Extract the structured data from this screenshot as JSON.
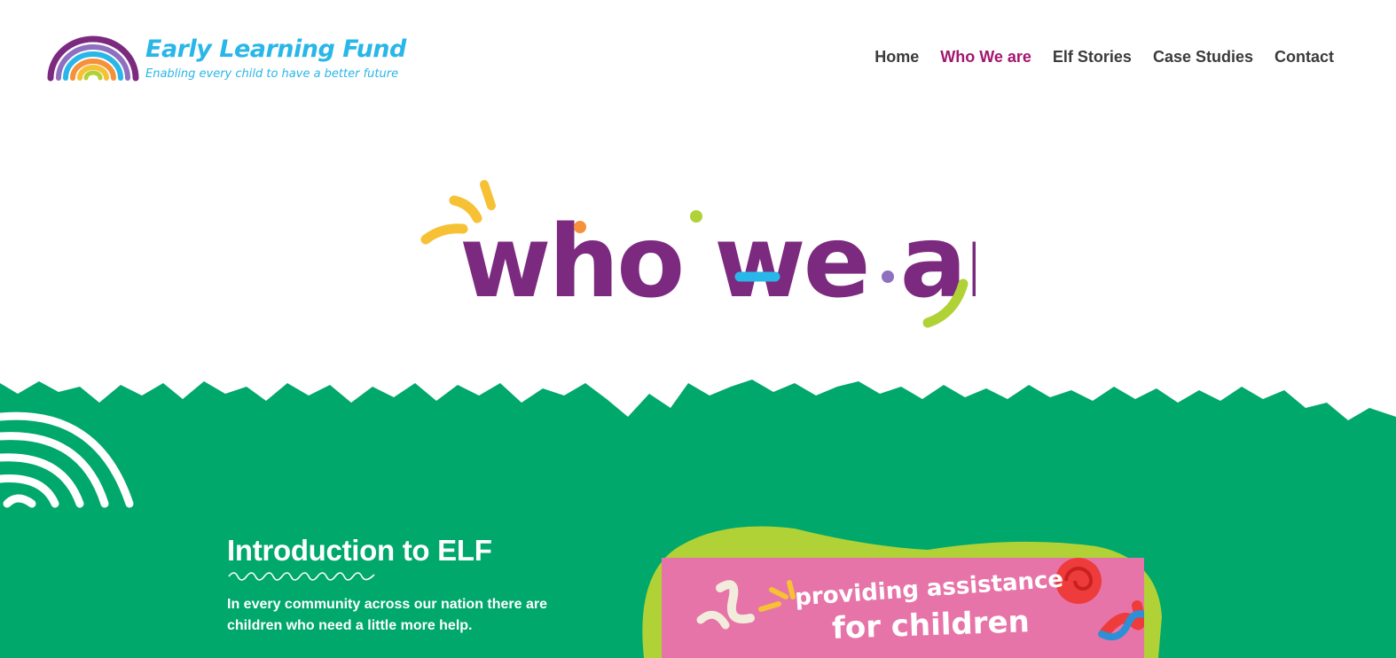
{
  "brand": {
    "name": "Early Learning Fund",
    "tagline": "Enabling every child to have a better future"
  },
  "nav": {
    "items": [
      {
        "label": "Home",
        "active": false
      },
      {
        "label": "Who We are",
        "active": true
      },
      {
        "label": "Elf Stories",
        "active": false
      },
      {
        "label": "Case Studies",
        "active": false
      },
      {
        "label": "Contact",
        "active": false
      }
    ]
  },
  "hero": {
    "title": "who we are"
  },
  "intro": {
    "heading": "Introduction to ELF",
    "text": "In every community across our nation there are children who need a little more help."
  },
  "feature_image": {
    "line1": "providing assistance",
    "line2": "for children"
  },
  "colors": {
    "green": "#00a86b",
    "purple": "#7b2a7f",
    "magenta": "#a3166f",
    "blue": "#29b6e8",
    "lime": "#b0d236",
    "pink": "#e774a8",
    "yellow": "#f6c134"
  }
}
